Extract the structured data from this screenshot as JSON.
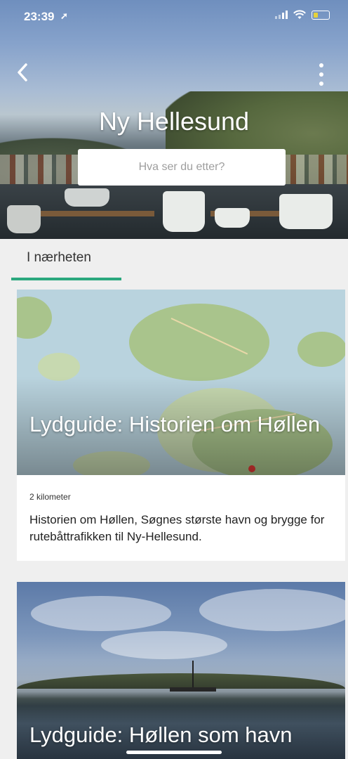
{
  "status_bar": {
    "time": "23:39"
  },
  "header": {
    "title": "Ny Hellesund",
    "search_placeholder": "Hva ser du etter?"
  },
  "tabs": [
    {
      "label": "I nærheten",
      "active": true
    }
  ],
  "cards": [
    {
      "title": "Lydguide: Historien om Høllen",
      "distance": "2 kilometer",
      "description": "Historien om Høllen, Søgnes største havn og brygge for rutebåttrafikken til Ny-Hellesund."
    },
    {
      "title": "Lydguide: Høllen som havn"
    }
  ],
  "colors": {
    "accent": "#2ba87e"
  },
  "icons": {
    "back": "chevron-left-icon",
    "more": "more-vertical-icon",
    "location": "location-arrow-icon",
    "wifi": "wifi-icon",
    "battery": "battery-icon"
  }
}
